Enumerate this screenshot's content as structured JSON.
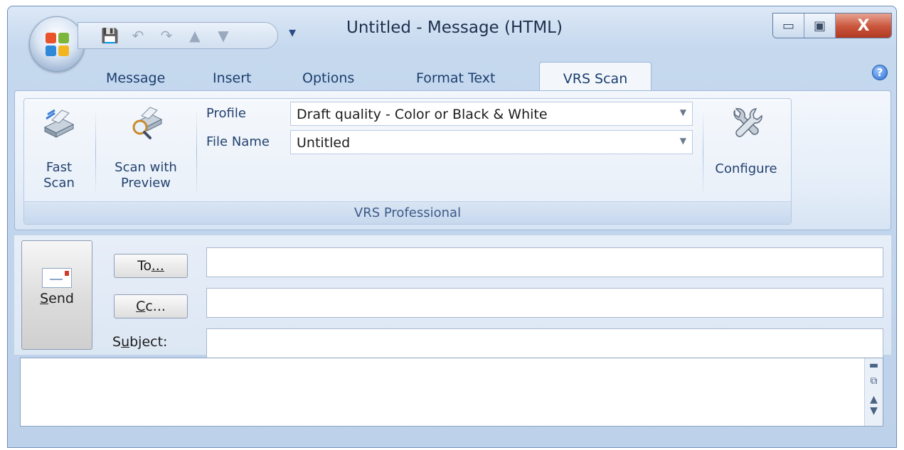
{
  "window": {
    "title": "Untitled - Message (HTML)",
    "minimize_glyph": "▭",
    "maximize_glyph": "▣",
    "close_glyph": "X"
  },
  "quick_access": {
    "save_icon": "💾",
    "undo_icon": "↶",
    "redo_icon": "↷",
    "prev_icon": "▲",
    "next_icon": "▼",
    "customize_icon": "▾"
  },
  "tabs": [
    {
      "label": "Message",
      "active": false
    },
    {
      "label": "Insert",
      "active": false
    },
    {
      "label": "Options",
      "active": false
    },
    {
      "label": "Format Text",
      "active": false
    },
    {
      "label": "VRS Scan",
      "active": true
    }
  ],
  "help_glyph": "?",
  "ribbon": {
    "group_label": "VRS Professional",
    "fast_scan": {
      "line1": "Fast",
      "line2": "Scan"
    },
    "scan_preview": {
      "line1": "Scan with",
      "line2": "Preview"
    },
    "profile_label": "Profile",
    "profile_value": "Draft quality - Color or Black & White",
    "filename_label": "File Name",
    "filename_value": "Untitled",
    "configure_label": "Configure"
  },
  "header": {
    "send_label_first": "S",
    "send_label_rest": "end",
    "to_label_pre": "To",
    "to_label_ul": "...",
    "cc_label_ul": "C",
    "cc_label_rest": "c...",
    "subject_label_pre": "S",
    "subject_label_ul": "u",
    "subject_label_rest": "bject:",
    "to_value": "",
    "cc_value": "",
    "subject_value": ""
  },
  "colors": {
    "accent": "#1e395b",
    "close": "#c9553b"
  }
}
